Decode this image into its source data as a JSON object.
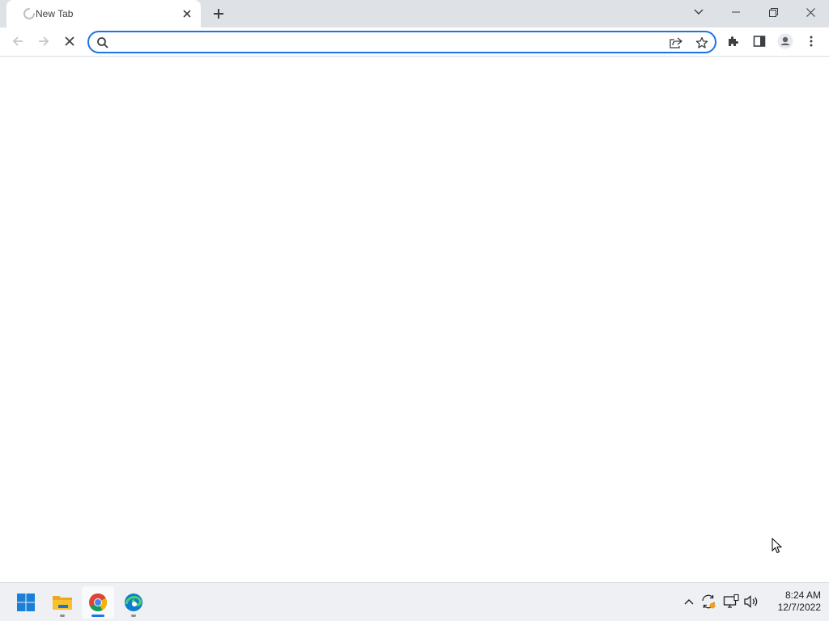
{
  "browser": {
    "tab": {
      "title": "New Tab"
    },
    "omnibox": {
      "value": "",
      "placeholder": ""
    }
  },
  "taskbar": {
    "apps": [
      {
        "name": "Start",
        "icon": "windows-start-icon"
      },
      {
        "name": "File Explorer",
        "icon": "file-explorer-icon"
      },
      {
        "name": "Google Chrome",
        "icon": "chrome-icon",
        "active": true
      },
      {
        "name": "Microsoft Edge",
        "icon": "edge-icon"
      }
    ],
    "clock": {
      "time": "8:24 AM",
      "date": "12/7/2022"
    }
  },
  "colors": {
    "accent": "#1a73e8",
    "tabstrip": "#dee1e6",
    "taskbar": "#eef0f3"
  }
}
